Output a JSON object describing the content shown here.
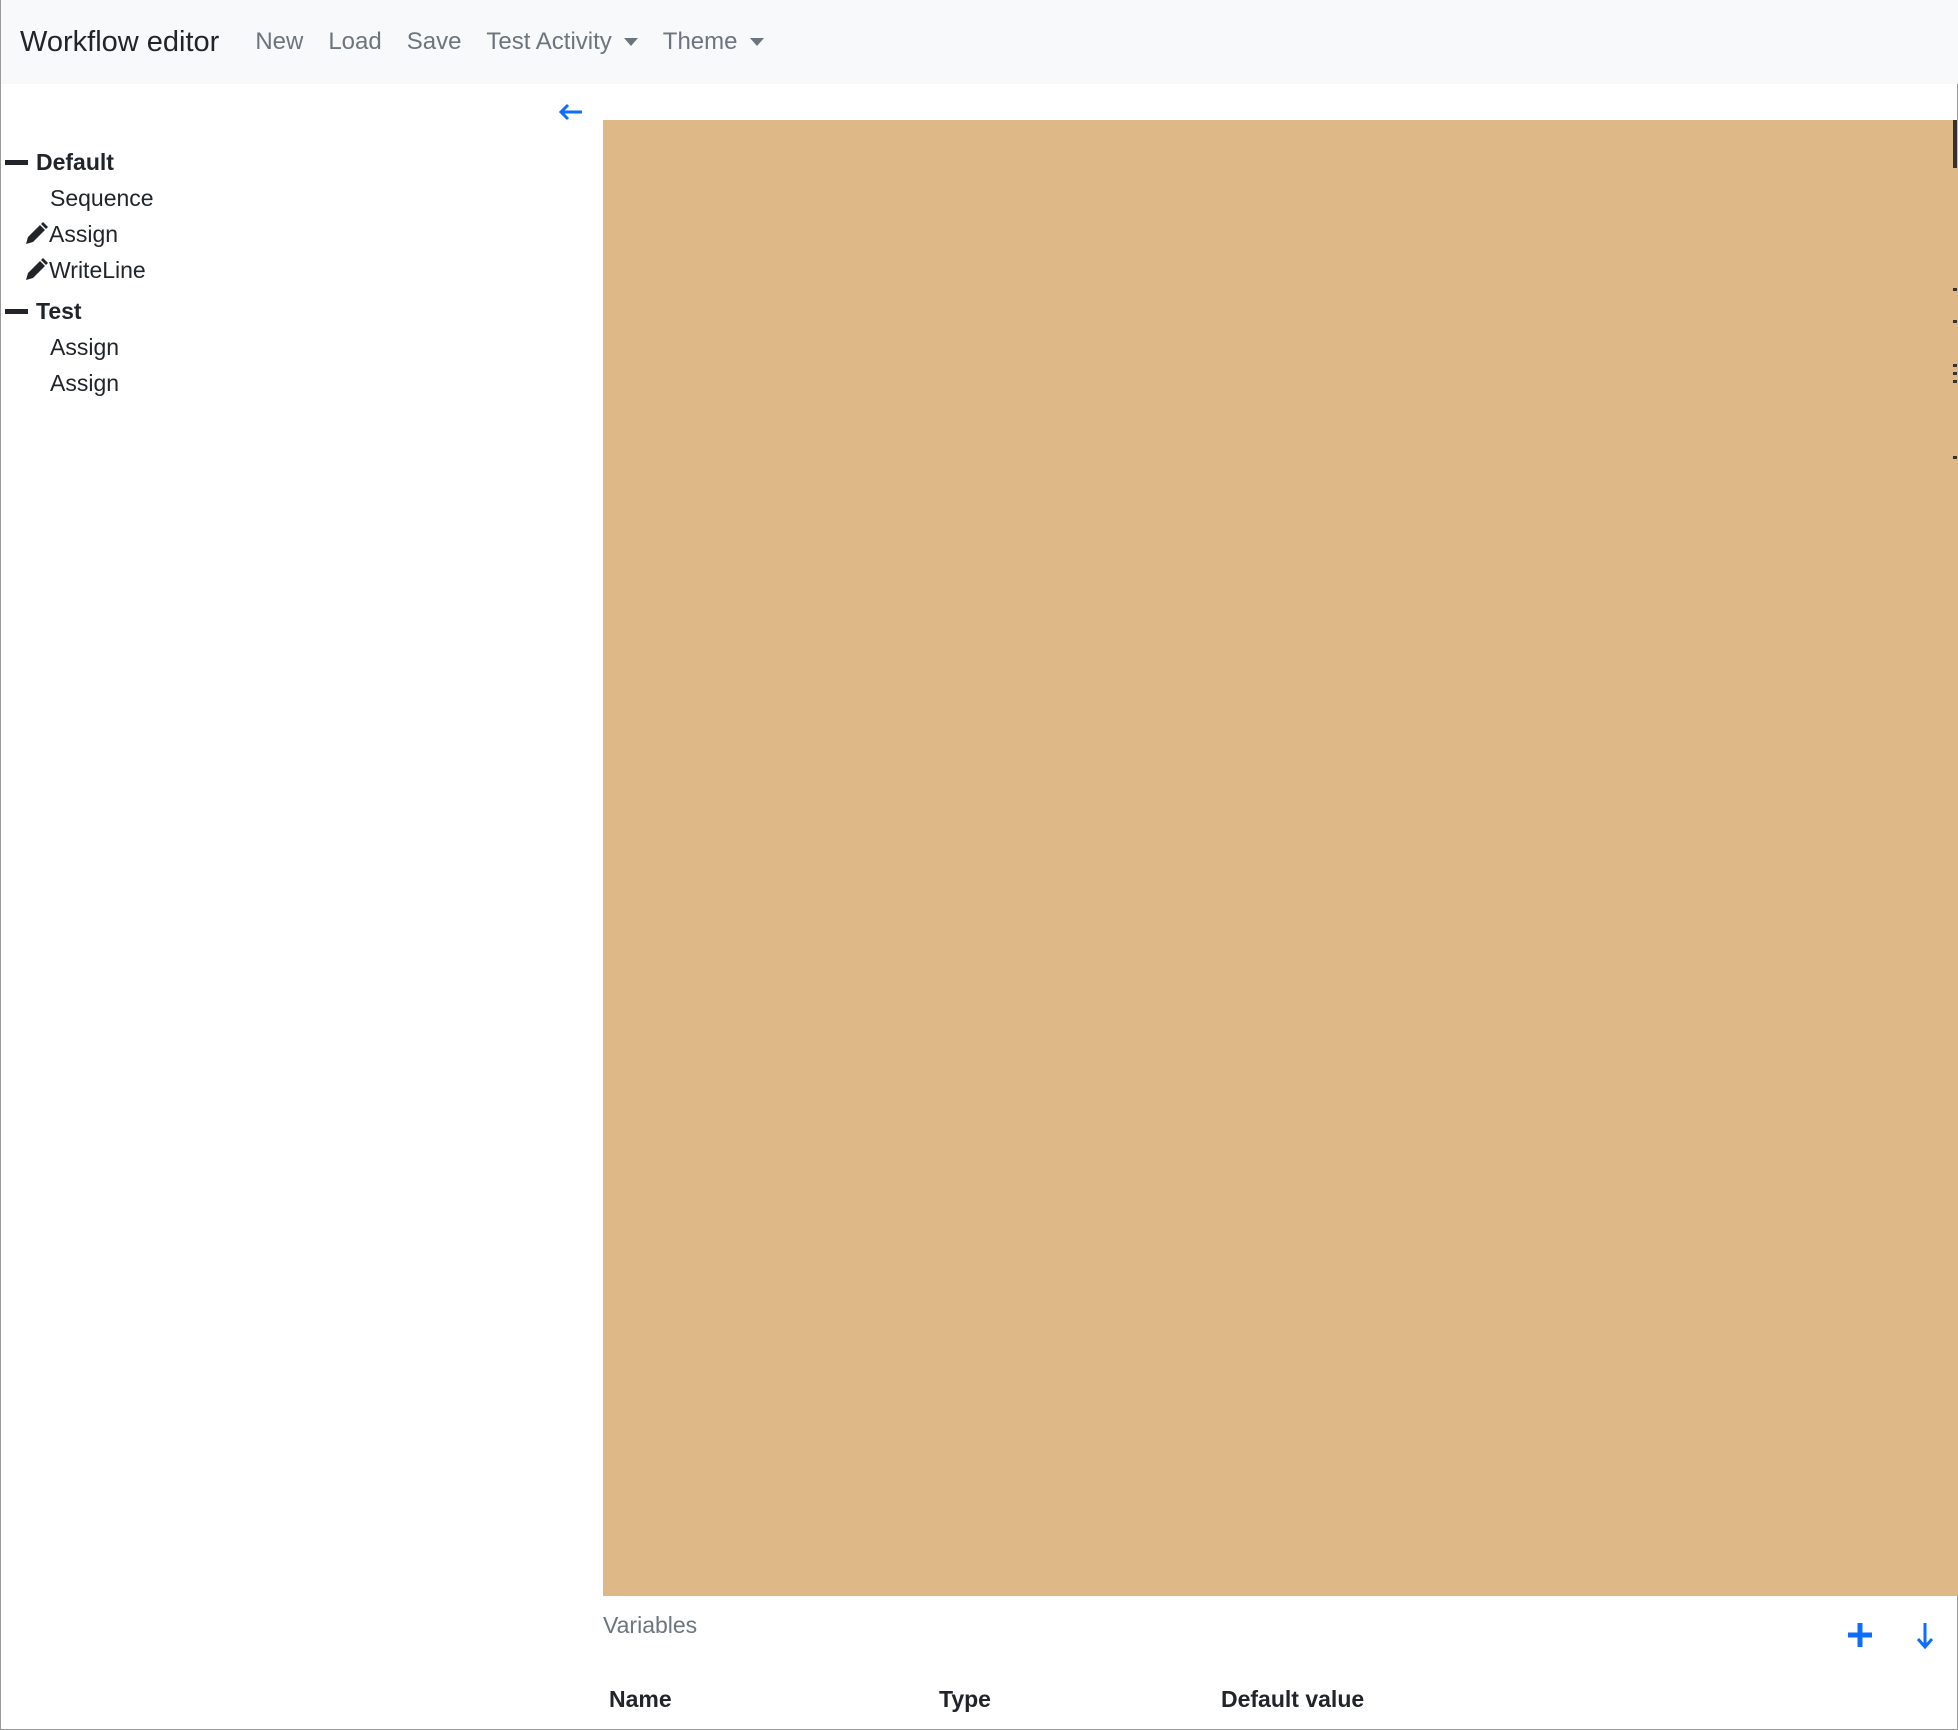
{
  "navbar": {
    "brand": "Workflow editor",
    "items": [
      {
        "label": "New"
      },
      {
        "label": "Load"
      },
      {
        "label": "Save"
      },
      {
        "label": "Test Activity"
      },
      {
        "label": "Theme"
      }
    ]
  },
  "sidebar": {
    "collapse_icon": "arrow-left-icon",
    "groups": [
      {
        "label": "Default",
        "items": [
          {
            "label": "Sequence"
          },
          {
            "label": "Assign"
          },
          {
            "label": "WriteLine"
          }
        ]
      },
      {
        "label": "Test",
        "items": [
          {
            "label": "Assign"
          },
          {
            "label": "Assign"
          }
        ]
      }
    ]
  },
  "canvas": {
    "background_color": "#deb887"
  },
  "variables": {
    "title": "Variables",
    "add_icon": "plus-icon",
    "download_icon": "arrow-down-icon",
    "columns": [
      "Name",
      "Type",
      "Default value"
    ]
  },
  "colors": {
    "accent": "#0d6efd",
    "navbar_bg": "#f8f9fa",
    "muted_text": "#6c757d"
  }
}
